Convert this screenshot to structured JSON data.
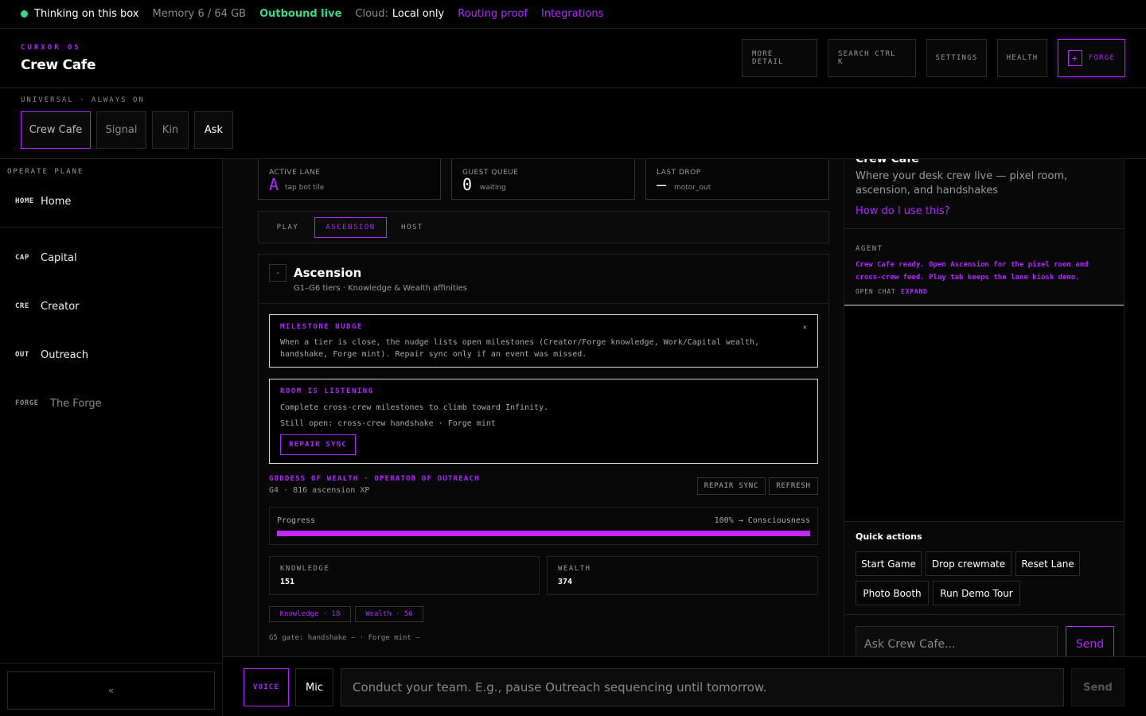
{
  "status_bar": {
    "thinking": "Thinking on this box",
    "memory": "Memory 6 / 64 GB",
    "outbound": "Outbound live",
    "cloud_label": "Cloud:",
    "cloud_value": "Local only",
    "routing": "Routing proof",
    "integrations": "Integrations",
    "colors": {
      "live": "#3fd68a",
      "accent": "#b026ff"
    }
  },
  "header": {
    "kicker": "CURXOR OS",
    "title": "Crew Cafe",
    "buttons": {
      "more_detail": "MORE DETAIL",
      "search": "SEARCH CTRL K",
      "settings": "SETTINGS",
      "health": "HEALTH",
      "forge": "FORGE"
    }
  },
  "universal": {
    "label": "UNIVERSAL · ALWAYS ON",
    "tabs": [
      "Crew Cafe",
      "Signal",
      "Kin",
      "Ask"
    ],
    "active": "Crew Cafe"
  },
  "sidebar": {
    "label": "OPERATE PLANE",
    "items": [
      {
        "code": "HOME",
        "label": "Home"
      },
      {
        "code": "CAP",
        "label": "Capital"
      },
      {
        "code": "CRE",
        "label": "Creator"
      },
      {
        "code": "OUT",
        "label": "Outreach"
      },
      {
        "code": "FORGE",
        "label": "The Forge"
      }
    ],
    "collapse_label": "«"
  },
  "main": {
    "stats": [
      {
        "label": "ACTIVE LANE",
        "value": "A",
        "sub": "tap bot tile"
      },
      {
        "label": "GUEST QUEUE",
        "value": "0",
        "sub": "waiting"
      },
      {
        "label": "LAST DROP",
        "value": "—",
        "sub": "motor_out"
      }
    ],
    "tabs": [
      "PLAY",
      "ASCENSION",
      "HOST"
    ],
    "active_tab": "ASCENSION",
    "panel": {
      "collapse_icon": "-",
      "title": "Ascension",
      "subtitle": "G1–G6 tiers · Knowledge & Wealth affinities",
      "nudge": {
        "title": "MILESTONE NUDGE",
        "close": "×",
        "body": "When a tier is close, the nudge lists open milestones (Creator/Forge knowledge, Work/Capital wealth, handshake, Forge mint). Repair sync only if an event was missed."
      },
      "listening": {
        "title": "ROOM IS LISTENING",
        "line1": "Complete cross-crew milestones to climb toward Infinity.",
        "line2": "Still open: cross-crew handshake · Forge mint",
        "button": "REPAIR SYNC"
      },
      "rank": "GODDESS OF WEALTH · OPERATOR OF OUTREACH",
      "xp": "G4 · 816 ascension XP",
      "repair_sync": "REPAIR SYNC",
      "refresh": "REFRESH",
      "progress": {
        "label": "Progress",
        "right": "100% → Consciousness",
        "percent": 100
      },
      "knowledge": {
        "label": "KNOWLEDGE",
        "value": "151"
      },
      "wealth": {
        "label": "WEALTH",
        "value": "374"
      },
      "chips": [
        "Knowledge · 18",
        "Wealth · 56"
      ],
      "gate": "G5 gate: handshake — · Forge mint —"
    }
  },
  "right_panel": {
    "title": "Crew Cafe",
    "description": "Where your desk crew live — pixel room, ascension, and handshakes",
    "help_link": "How do I use this?",
    "agent_label": "AGENT",
    "agent_message": "Crew Cafe ready. Open Ascension for the pixel room and cross-crew feed. Play tab keeps the lane kiosk demo.",
    "open_chat": "OPEN CHAT",
    "expand": "EXPAND",
    "quick_actions_label": "Quick actions",
    "quick_actions": [
      "Start Game",
      "Drop crewmate",
      "Reset Lane",
      "Photo Booth",
      "Run Demo Tour"
    ],
    "ask_placeholder": "Ask Crew Cafe...",
    "send": "Send"
  },
  "composer": {
    "voice": "VOICE",
    "mic": "Mic",
    "placeholder": "Conduct your team. E.g., pause Outreach sequencing until tomorrow.",
    "send": "Send"
  }
}
